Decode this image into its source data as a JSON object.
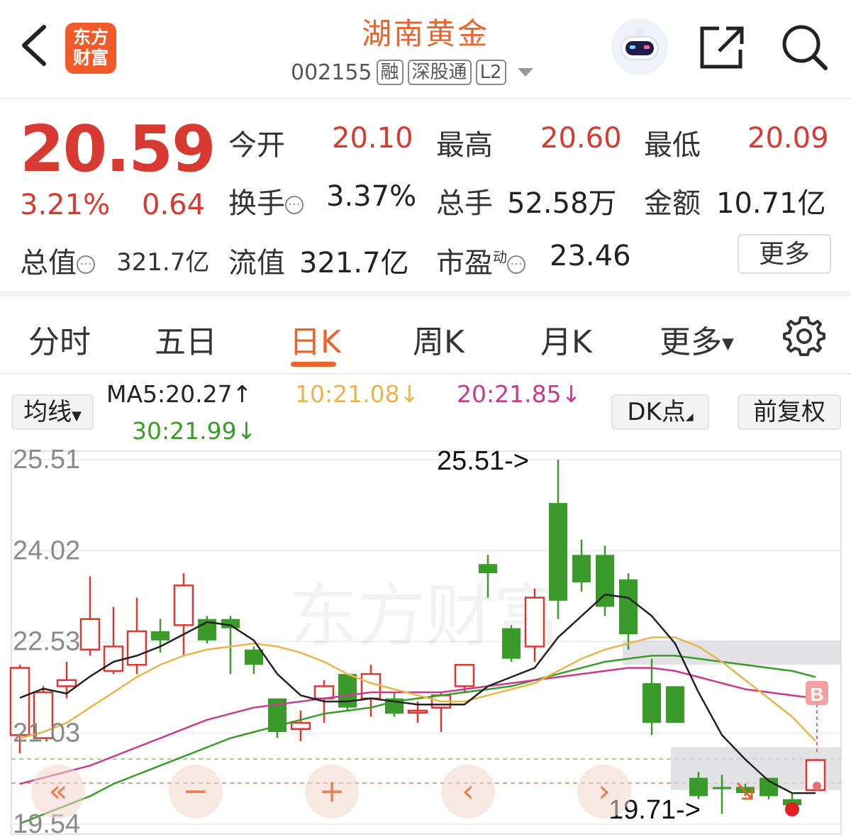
{
  "header": {
    "title": "湖南黄金",
    "logo_lines": [
      "东方",
      "财富"
    ],
    "code": "002155",
    "tags": [
      "融",
      "深股通",
      "L2"
    ]
  },
  "quote": {
    "price": "20.59",
    "change_pct": "3.21%",
    "change": "0.64",
    "rows": [
      [
        {
          "label": "今开",
          "value": "20.10",
          "color": "red"
        },
        {
          "label": "最高",
          "value": "20.60",
          "color": "red"
        },
        {
          "label": "最低",
          "value": "20.09",
          "color": "red"
        }
      ],
      [
        {
          "label": "换手",
          "value": "3.37%",
          "info": true
        },
        {
          "label": "总手",
          "value": "52.58万"
        },
        {
          "label": "金额",
          "value": "10.71亿"
        }
      ],
      [
        {
          "label": "总值",
          "value": "321.7亿",
          "info": true
        },
        {
          "label": "流值",
          "value": "321.7亿"
        },
        {
          "label": "市盈",
          "sup": "动",
          "value": "23.46",
          "info": true
        }
      ]
    ],
    "more_label": "更多"
  },
  "tabs": [
    "分时",
    "五日",
    "日K",
    "周K",
    "月K",
    "更多"
  ],
  "active_tab": "日K",
  "ma_bar": {
    "select_label": "均线",
    "ma5": "MA5:20.27↑",
    "ma10": "10:21.08↓",
    "ma20": "20:21.85↓",
    "ma30": "30:21.99↓",
    "dk_label": "DK点",
    "fq_label": "前复权"
  },
  "colors": {
    "up": "#d83a32",
    "down": "#3a9a2a",
    "accent": "#e8642c",
    "ma5": "#222222",
    "ma10": "#e8b54a",
    "ma20": "#c83a8e",
    "ma30": "#3a9a2a"
  },
  "chart_data": {
    "type": "candlestick",
    "y_ticks": [
      "25.51",
      "24.02",
      "22.53",
      "21.03",
      "19.54"
    ],
    "ylim": [
      19.54,
      25.51
    ],
    "max_marker": "25.51->",
    "min_marker": "19.71->",
    "watermark": "东方财富",
    "signal_badge": "B",
    "candles": [
      {
        "o": 21.0,
        "c": 22.1,
        "h": 22.15,
        "l": 20.7
      },
      {
        "o": 20.95,
        "c": 21.7,
        "h": 21.8,
        "l": 20.95
      },
      {
        "o": 21.8,
        "c": 21.9,
        "h": 22.2,
        "l": 21.6
      },
      {
        "o": 22.4,
        "c": 22.9,
        "h": 23.6,
        "l": 22.3
      },
      {
        "o": 22.05,
        "c": 22.45,
        "h": 23.1,
        "l": 22.0
      },
      {
        "o": 22.15,
        "c": 22.7,
        "h": 23.25,
        "l": 22.0
      },
      {
        "o": 22.7,
        "c": 22.55,
        "h": 22.9,
        "l": 22.35
      },
      {
        "o": 22.8,
        "c": 23.45,
        "h": 23.65,
        "l": 22.3
      },
      {
        "o": 22.9,
        "c": 22.55,
        "h": 22.95,
        "l": 22.5
      },
      {
        "o": 22.9,
        "c": 22.75,
        "h": 22.95,
        "l": 22.0
      },
      {
        "o": 22.4,
        "c": 22.15,
        "h": 22.45,
        "l": 22.0
      },
      {
        "o": 21.6,
        "c": 21.05,
        "h": 21.6,
        "l": 20.95
      },
      {
        "o": 21.1,
        "c": 21.2,
        "h": 21.4,
        "l": 20.9
      },
      {
        "o": 21.6,
        "c": 21.8,
        "h": 21.9,
        "l": 21.2
      },
      {
        "o": 22.0,
        "c": 21.45,
        "h": 22.0,
        "l": 21.4
      },
      {
        "o": 21.6,
        "c": 22.0,
        "h": 22.15,
        "l": 21.3
      },
      {
        "o": 21.6,
        "c": 21.35,
        "h": 21.7,
        "l": 21.3
      },
      {
        "o": 21.4,
        "c": 21.4,
        "h": 21.55,
        "l": 21.2
      },
      {
        "o": 21.45,
        "c": 21.65,
        "h": 21.7,
        "l": 21.05
      },
      {
        "o": 21.8,
        "c": 22.15,
        "h": 22.15,
        "l": 21.7
      },
      {
        "o": 23.8,
        "c": 23.65,
        "h": 23.95,
        "l": 23.25
      },
      {
        "o": 22.75,
        "c": 22.25,
        "h": 22.8,
        "l": 22.2
      },
      {
        "o": 22.45,
        "c": 23.25,
        "h": 23.4,
        "l": 22.2
      },
      {
        "o": 24.8,
        "c": 23.2,
        "h": 25.51,
        "l": 22.9
      },
      {
        "o": 23.95,
        "c": 23.5,
        "h": 24.2,
        "l": 23.35
      },
      {
        "o": 23.95,
        "c": 23.1,
        "h": 24.1,
        "l": 22.95
      },
      {
        "o": 23.55,
        "c": 22.65,
        "h": 23.65,
        "l": 22.4
      },
      {
        "o": 21.85,
        "c": 21.2,
        "h": 22.25,
        "l": 21.0
      },
      {
        "o": 21.8,
        "c": 21.2,
        "h": 21.8,
        "l": 21.2
      },
      {
        "o": 20.3,
        "c": 20.0,
        "h": 20.4,
        "l": 19.95
      },
      {
        "o": 20.15,
        "c": 20.12,
        "h": 20.35,
        "l": 19.71
      },
      {
        "o": 20.15,
        "c": 20.05,
        "h": 20.2,
        "l": 20.0
      },
      {
        "o": 20.3,
        "c": 20.0,
        "h": 20.3,
        "l": 19.95
      },
      {
        "o": 19.95,
        "c": 19.85,
        "h": 20.05,
        "l": 19.8
      },
      {
        "o": 20.1,
        "c": 20.59,
        "h": 20.6,
        "l": 20.09
      }
    ],
    "ma5": [
      21.61,
      21.76,
      21.68,
      21.96,
      22.2,
      22.3,
      22.45,
      22.65,
      22.85,
      22.8,
      22.55,
      22.0,
      21.65,
      21.55,
      21.55,
      21.6,
      21.55,
      21.5,
      21.5,
      21.5,
      21.8,
      21.95,
      22.1,
      22.6,
      22.95,
      23.3,
      23.25,
      22.95,
      22.5,
      21.7,
      21.0,
      20.6,
      20.25,
      20.05,
      20.05
    ],
    "ma10": [
      20.95,
      21.05,
      21.2,
      21.45,
      21.7,
      21.95,
      22.15,
      22.3,
      22.4,
      22.45,
      22.5,
      22.45,
      22.35,
      22.2,
      22.0,
      21.85,
      21.75,
      21.65,
      21.55,
      21.55,
      21.65,
      21.75,
      21.85,
      22.05,
      22.25,
      22.4,
      22.5,
      22.6,
      22.6,
      22.45,
      22.2,
      21.9,
      21.6,
      21.3,
      20.9
    ],
    "ma20": [
      20.2,
      20.3,
      20.4,
      20.5,
      20.65,
      20.8,
      20.95,
      21.1,
      21.25,
      21.35,
      21.45,
      21.5,
      21.55,
      21.6,
      21.65,
      21.7,
      21.7,
      21.7,
      21.7,
      21.75,
      21.8,
      21.85,
      21.9,
      21.95,
      22.0,
      22.05,
      22.1,
      22.1,
      22.05,
      21.95,
      21.85,
      21.75,
      21.7,
      21.65,
      21.6
    ],
    "ma30": [
      19.55,
      19.7,
      19.85,
      20.0,
      20.2,
      20.35,
      20.5,
      20.65,
      20.8,
      20.95,
      21.05,
      21.15,
      21.25,
      21.35,
      21.4,
      21.45,
      21.55,
      21.6,
      21.65,
      21.7,
      21.75,
      21.8,
      21.9,
      22.0,
      22.1,
      22.2,
      22.25,
      22.3,
      22.3,
      22.25,
      22.2,
      22.15,
      22.1,
      22.05,
      21.95
    ],
    "zones": [
      [
        22.15,
        22.55
      ],
      [
        20.1,
        20.8
      ]
    ],
    "nav_buttons": [
      "«",
      "−",
      "+",
      "‹",
      "›"
    ]
  }
}
